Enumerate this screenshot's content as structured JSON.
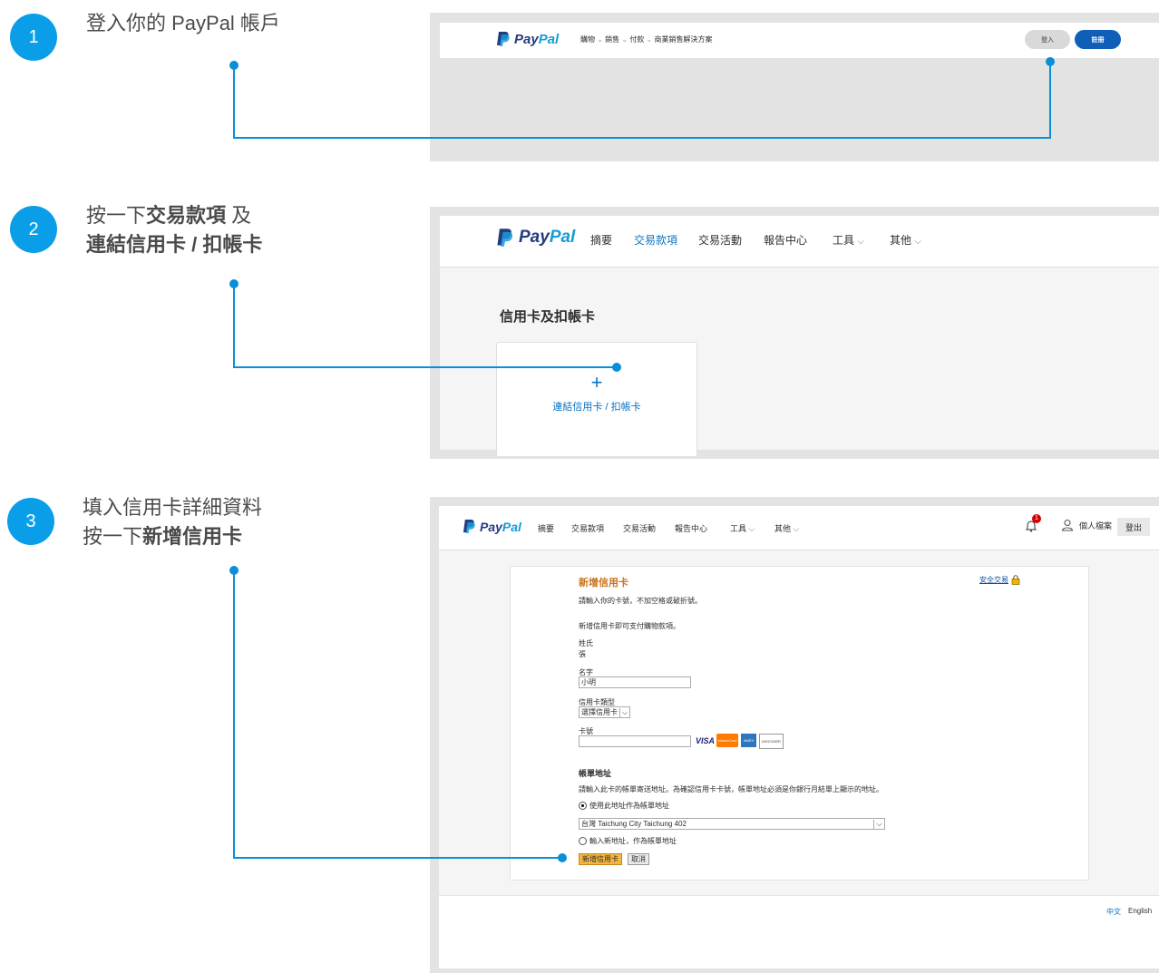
{
  "step1": {
    "number": "1",
    "text": "登入你的 PayPal 帳戶",
    "header": {
      "logo": "PayPal",
      "nav": [
        "購物",
        "銷售",
        "付款",
        "商業銷售解決方案"
      ],
      "login_label": "登入",
      "signup_label": "註冊"
    }
  },
  "step2": {
    "number": "2",
    "text_line1_prefix": "按一下",
    "text_line1_bold": "交易款項",
    "text_line1_suffix": " 及",
    "text_line2_bold": "連結信用卡 / 扣帳卡",
    "header": {
      "logo": "PayPal",
      "nav": [
        "摘要",
        "交易款項",
        "交易活動",
        "報告中心",
        "工具",
        "其他"
      ]
    },
    "section_title": "信用卡及扣帳卡",
    "link_card_label": "連結信用卡 / 扣帳卡",
    "plus": "+"
  },
  "step3": {
    "number": "3",
    "text_line1": "填入信用卡詳細資料",
    "text_line2_prefix": "按一下",
    "text_line2_bold": "新增信用卡",
    "header": {
      "logo": "PayPal",
      "nav": [
        "摘要",
        "交易款項",
        "交易活動",
        "報告中心",
        "工具",
        "其他"
      ],
      "notification_count": "1",
      "profile_label": "個人檔案",
      "logout_label": "登出"
    },
    "form": {
      "title": "新增信用卡",
      "secure_link": "安全交易",
      "instruction": "請輸入你的卡號，不加空格或破折號。",
      "note": "新增信用卡即可支付購物款項。",
      "last_name_label": "姓氏",
      "last_name_value": "張",
      "first_name_label": "名字",
      "first_name_value": "小明",
      "card_type_label": "信用卡類型",
      "card_type_value": "選擇信用卡",
      "card_number_label": "卡號",
      "card_number_value": "",
      "card_brands": [
        "VISA",
        "MasterCard",
        "AMEX",
        "DISCOVER"
      ],
      "billing_title": "帳單地址",
      "billing_instruction": "請輸入此卡的帳單寄送地址。為確認信用卡卡號，帳單地址必須是你銀行月結單上顯示的地址。",
      "use_address_label": "使用此地址作為帳單地址",
      "address_value": "台灣 Taichung City Taichung 402",
      "new_address_label": "輸入新地址，作為帳單地址",
      "submit_label": "新增信用卡",
      "cancel_label": "取消"
    },
    "footer": {
      "lang_zh": "中文",
      "lang_en": "English"
    }
  },
  "colors": {
    "step_circle": "#0a9ee8",
    "connector": "#0a8fd6",
    "paypal_dark": "#253b80",
    "paypal_light": "#179bd7",
    "signup_button": "#0f5fb8",
    "form_title": "#c9741b",
    "submit_button": "#f4b63f"
  }
}
